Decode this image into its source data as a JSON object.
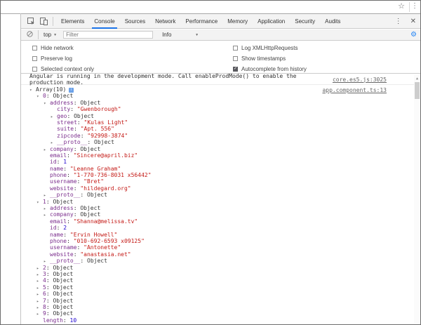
{
  "theme": {
    "accent_blue": "#1a73e8",
    "gear_blue": "#2787f5",
    "key_color": "#7b2e8d",
    "string_color": "#c41a16",
    "number_color": "#1c00cf"
  },
  "browser": {
    "star_icon": "☆",
    "menu_icon": "⋮"
  },
  "devtools": {
    "tab_bar": {
      "tabs": [
        "Elements",
        "Console",
        "Sources",
        "Network",
        "Performance",
        "Memory",
        "Application",
        "Security",
        "Audits"
      ],
      "active_tab": "Console",
      "more_icon": "⋮",
      "close_icon": "✕"
    },
    "toolbar": {
      "context_select": "top",
      "filter_placeholder": "Filter",
      "level_select": "Info"
    },
    "settings": {
      "left": [
        {
          "label": "Hide network",
          "checked": false
        },
        {
          "label": "Preserve log",
          "checked": false
        },
        {
          "label": "Selected context only",
          "checked": false
        }
      ],
      "right": [
        {
          "label": "Log XMLHttpRequests",
          "checked": false
        },
        {
          "label": "Show timestamps",
          "checked": false
        },
        {
          "label": "Autocomplete from history",
          "checked": true
        }
      ]
    }
  },
  "console": {
    "info_message": {
      "text": "Angular is running in the development mode. Call enableProdMode() to enable the production mode.",
      "source": "core.es5.js:3025"
    },
    "log_source": "app.component.ts:13",
    "tree": [
      {
        "indent": 0,
        "arrow": "down",
        "key": "",
        "value": "Array(10)",
        "type": "object",
        "badge": "i"
      },
      {
        "indent": 1,
        "arrow": "down",
        "key": "0",
        "value": "Object",
        "type": "object"
      },
      {
        "indent": 2,
        "arrow": "down",
        "key": "address",
        "value": "Object",
        "type": "object"
      },
      {
        "indent": 3,
        "arrow": "",
        "key": "city",
        "value": "\"Gwenborough\"",
        "type": "string"
      },
      {
        "indent": 3,
        "arrow": "right",
        "key": "geo",
        "value": "Object",
        "type": "object"
      },
      {
        "indent": 3,
        "arrow": "",
        "key": "street",
        "value": "\"Kulas Light\"",
        "type": "string"
      },
      {
        "indent": 3,
        "arrow": "",
        "key": "suite",
        "value": "\"Apt. 556\"",
        "type": "string"
      },
      {
        "indent": 3,
        "arrow": "",
        "key": "zipcode",
        "value": "\"92998-3874\"",
        "type": "string"
      },
      {
        "indent": 3,
        "arrow": "right",
        "key": "__proto__",
        "value": "Object",
        "type": "object"
      },
      {
        "indent": 2,
        "arrow": "right",
        "key": "company",
        "value": "Object",
        "type": "object"
      },
      {
        "indent": 2,
        "arrow": "",
        "key": "email",
        "value": "\"Sincere@april.biz\"",
        "type": "string"
      },
      {
        "indent": 2,
        "arrow": "",
        "key": "id",
        "value": "1",
        "type": "number"
      },
      {
        "indent": 2,
        "arrow": "",
        "key": "name",
        "value": "\"Leanne Graham\"",
        "type": "string"
      },
      {
        "indent": 2,
        "arrow": "",
        "key": "phone",
        "value": "\"1-770-736-8031 x56442\"",
        "type": "string"
      },
      {
        "indent": 2,
        "arrow": "",
        "key": "username",
        "value": "\"Bret\"",
        "type": "string"
      },
      {
        "indent": 2,
        "arrow": "",
        "key": "website",
        "value": "\"hildegard.org\"",
        "type": "string"
      },
      {
        "indent": 2,
        "arrow": "right",
        "key": "__proto__",
        "value": "Object",
        "type": "object"
      },
      {
        "indent": 1,
        "arrow": "down",
        "key": "1",
        "value": "Object",
        "type": "object"
      },
      {
        "indent": 2,
        "arrow": "right",
        "key": "address",
        "value": "Object",
        "type": "object"
      },
      {
        "indent": 2,
        "arrow": "right",
        "key": "company",
        "value": "Object",
        "type": "object"
      },
      {
        "indent": 2,
        "arrow": "",
        "key": "email",
        "value": "\"Shanna@melissa.tv\"",
        "type": "string"
      },
      {
        "indent": 2,
        "arrow": "",
        "key": "id",
        "value": "2",
        "type": "number"
      },
      {
        "indent": 2,
        "arrow": "",
        "key": "name",
        "value": "\"Ervin Howell\"",
        "type": "string"
      },
      {
        "indent": 2,
        "arrow": "",
        "key": "phone",
        "value": "\"010-692-6593 x09125\"",
        "type": "string"
      },
      {
        "indent": 2,
        "arrow": "",
        "key": "username",
        "value": "\"Antonette\"",
        "type": "string"
      },
      {
        "indent": 2,
        "arrow": "",
        "key": "website",
        "value": "\"anastasia.net\"",
        "type": "string"
      },
      {
        "indent": 2,
        "arrow": "right",
        "key": "__proto__",
        "value": "Object",
        "type": "object"
      },
      {
        "indent": 1,
        "arrow": "right",
        "key": "2",
        "value": "Object",
        "type": "object"
      },
      {
        "indent": 1,
        "arrow": "right",
        "key": "3",
        "value": "Object",
        "type": "object"
      },
      {
        "indent": 1,
        "arrow": "right",
        "key": "4",
        "value": "Object",
        "type": "object"
      },
      {
        "indent": 1,
        "arrow": "right",
        "key": "5",
        "value": "Object",
        "type": "object"
      },
      {
        "indent": 1,
        "arrow": "right",
        "key": "6",
        "value": "Object",
        "type": "object"
      },
      {
        "indent": 1,
        "arrow": "right",
        "key": "7",
        "value": "Object",
        "type": "object"
      },
      {
        "indent": 1,
        "arrow": "right",
        "key": "8",
        "value": "Object",
        "type": "object"
      },
      {
        "indent": 1,
        "arrow": "right",
        "key": "9",
        "value": "Object",
        "type": "object"
      },
      {
        "indent": 1,
        "arrow": "",
        "key": "length",
        "value": "10",
        "type": "number"
      }
    ]
  }
}
